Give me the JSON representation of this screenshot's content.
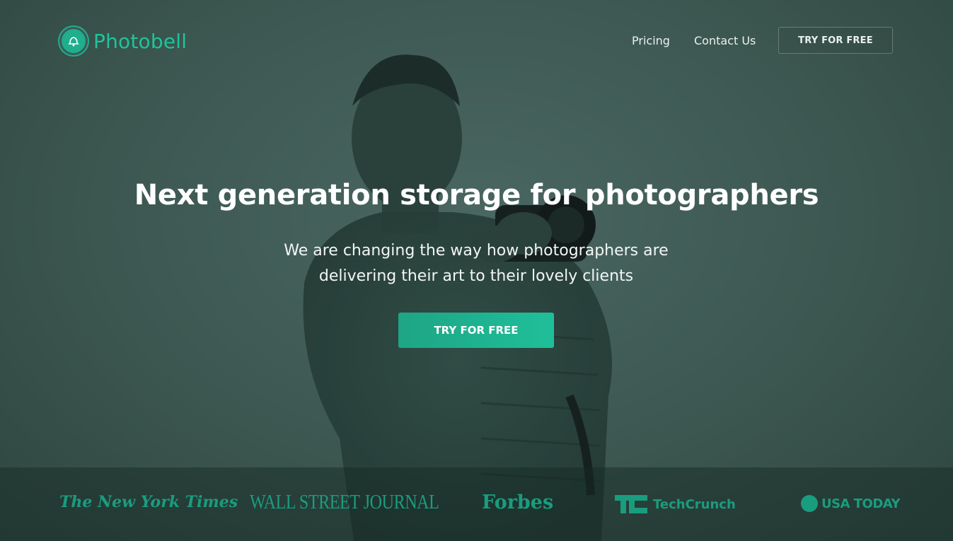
{
  "brand": {
    "name": "Photobell",
    "icon": "bell-icon",
    "color": "#1fc49c"
  },
  "nav": {
    "links": [
      {
        "label": "Pricing"
      },
      {
        "label": "Contact Us"
      }
    ],
    "cta_label": "TRY FOR FREE"
  },
  "hero": {
    "headline": "Next generation storage for photographers",
    "subhead_line1": "We are changing the way how photographers are",
    "subhead_line2": "delivering their art to their lovely clients",
    "cta_label": "TRY FOR FREE",
    "cta_color": "#1fb592"
  },
  "press": {
    "logos": [
      {
        "name": "The New York Times",
        "text": "The New York Times"
      },
      {
        "name": "Wall Street Journal",
        "text": "WALL STREET JOURNAL"
      },
      {
        "name": "Forbes",
        "text": "Forbes"
      },
      {
        "name": "TechCrunch",
        "text": "TechCrunch"
      },
      {
        "name": "USA Today",
        "text": "USA TODAY"
      }
    ],
    "color": "#1a9c7f"
  }
}
